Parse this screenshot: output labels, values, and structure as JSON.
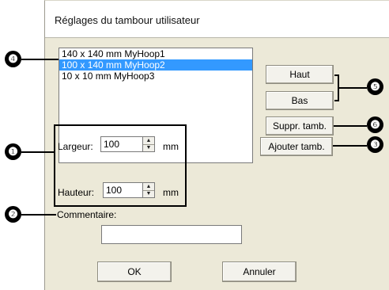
{
  "dialog": {
    "title": "Réglages du tambour utilisateur"
  },
  "hoop_list": {
    "items": [
      "140 x 140 mm MyHoop1",
      "100 x 140 mm MyHoop2",
      "10 x 10 mm MyHoop3"
    ],
    "selected_index": 1
  },
  "buttons": {
    "up": "Haut",
    "down": "Bas",
    "delete": "Suppr. tamb.",
    "add": "Ajouter tamb.",
    "ok": "OK",
    "cancel": "Annuler"
  },
  "size": {
    "width_label": "Largeur:",
    "width_value": "100",
    "height_label": "Hauteur:",
    "height_value": "100",
    "unit": "mm"
  },
  "comment": {
    "label": "Commentaire:",
    "value": ""
  },
  "callouts": {
    "one": "❶",
    "two": "❷",
    "three": "❸",
    "four": "❹",
    "five": "❺",
    "six": "❻"
  }
}
